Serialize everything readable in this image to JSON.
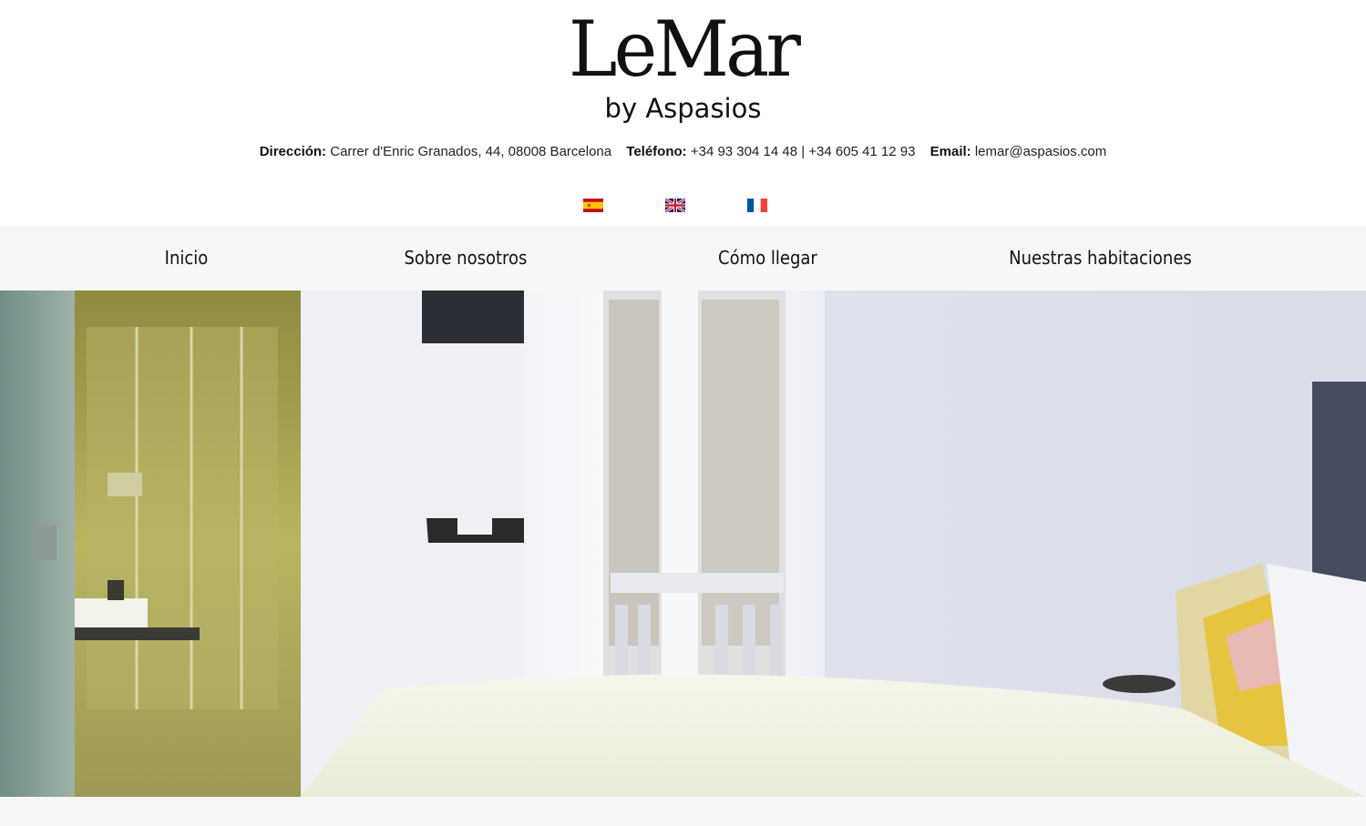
{
  "brand": {
    "name": "LeMar",
    "sub": "by Aspasios"
  },
  "contact": {
    "address_label": "Dirección:",
    "address_value": "Carrer d'Enric Granados, 44, 08008 Barcelona",
    "phone_label": "Teléfono:",
    "phone_value": "+34 93 304 14 48 | +34 605 41 12 93",
    "email_label": "Email:",
    "email_value": "lemar@aspasios.com"
  },
  "languages": [
    {
      "code": "es",
      "icon": "spain-flag-icon"
    },
    {
      "code": "en",
      "icon": "uk-flag-icon"
    },
    {
      "code": "fr",
      "icon": "france-flag-icon"
    }
  ],
  "nav": {
    "items": [
      {
        "label": "Inicio"
      },
      {
        "label": "Sobre nosotros"
      },
      {
        "label": "Cómo llegar"
      },
      {
        "label": "Nuestras habitaciones"
      }
    ]
  },
  "colors": {
    "nav_bg": "#f7f7f7",
    "text": "#111111"
  }
}
